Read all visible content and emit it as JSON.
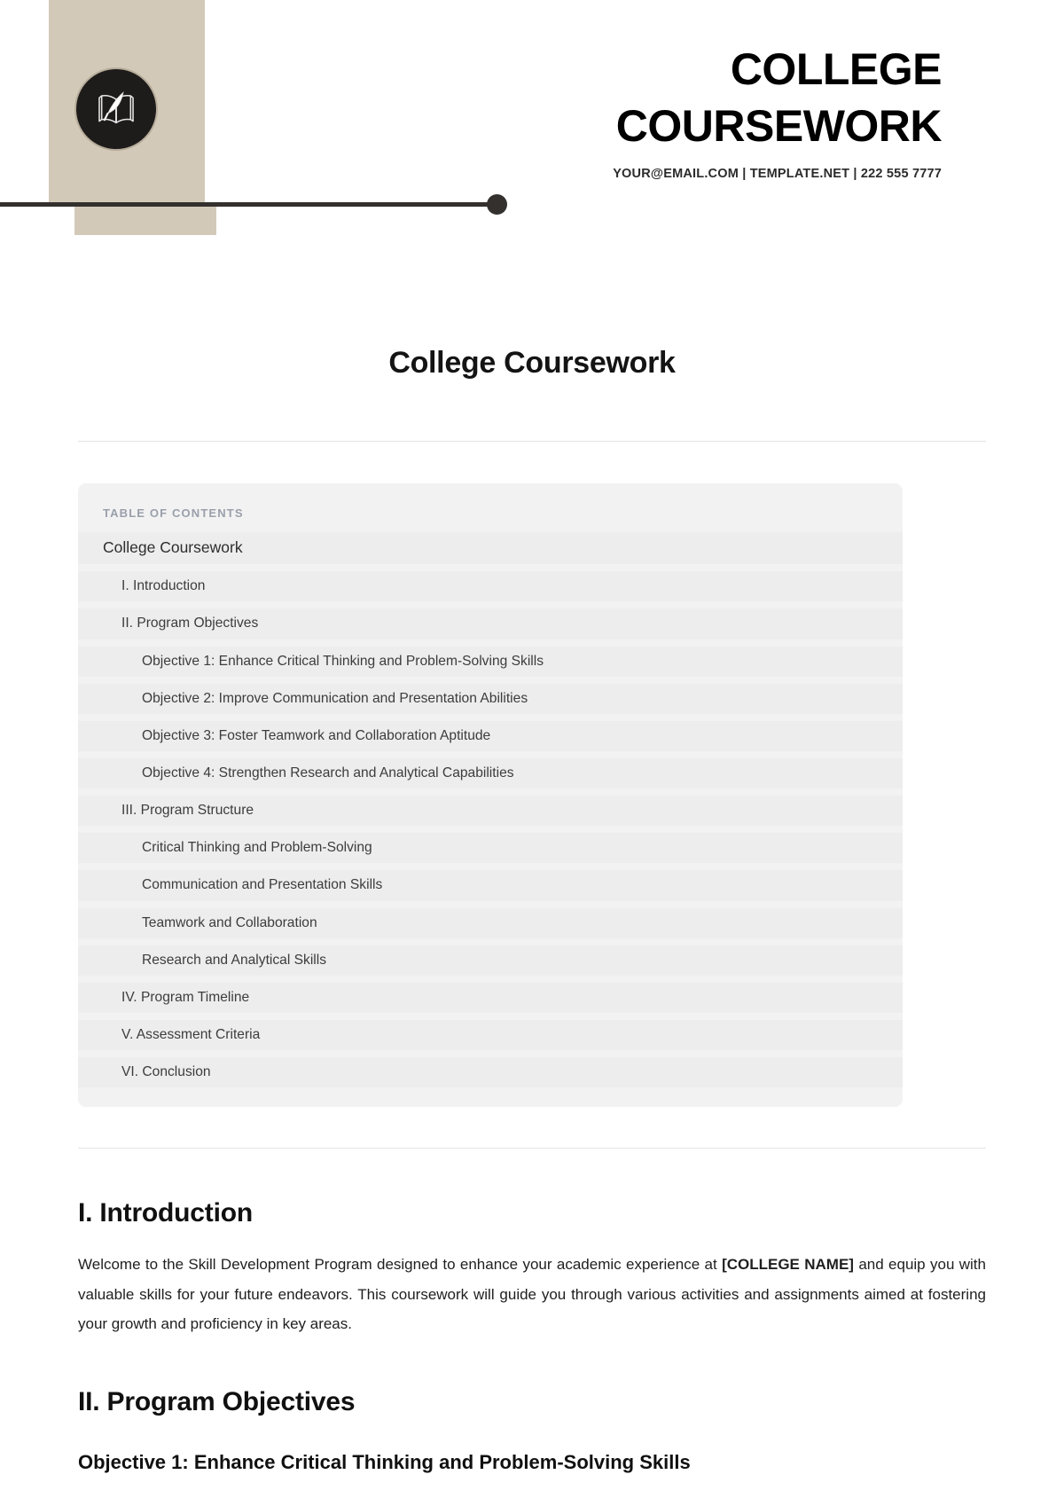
{
  "header": {
    "logo_icon": "open-book-quill-icon",
    "title_lines": [
      "COLLEGE",
      "COURSEWORK"
    ],
    "contact": "YOUR@EMAIL.COM | TEMPLATE.NET | 222 555 7777",
    "accent_beige": "#d3c9b8",
    "accent_dark": "#33302e"
  },
  "document": {
    "title": "College Coursework"
  },
  "toc": {
    "label": "TABLE OF CONTENTS",
    "items": [
      {
        "text": "College Coursework",
        "level": 0
      },
      {
        "text": "I. Introduction",
        "level": 1
      },
      {
        "text": "II. Program Objectives",
        "level": 1
      },
      {
        "text": "Objective 1: Enhance Critical Thinking and Problem-Solving Skills",
        "level": 2
      },
      {
        "text": "Objective 2: Improve Communication and Presentation Abilities",
        "level": 2
      },
      {
        "text": "Objective 3: Foster Teamwork and Collaboration Aptitude",
        "level": 2
      },
      {
        "text": "Objective 4: Strengthen Research and Analytical Capabilities",
        "level": 2
      },
      {
        "text": "III. Program Structure",
        "level": 1
      },
      {
        "text": "Critical Thinking and Problem-Solving",
        "level": 2
      },
      {
        "text": "Communication and Presentation Skills",
        "level": 2
      },
      {
        "text": "Teamwork and Collaboration",
        "level": 2
      },
      {
        "text": "Research and Analytical Skills",
        "level": 2
      },
      {
        "text": "IV. Program Timeline",
        "level": 1
      },
      {
        "text": "V. Assessment Criteria",
        "level": 1
      },
      {
        "text": "VI. Conclusion",
        "level": 1
      }
    ]
  },
  "sections": {
    "introduction": {
      "heading": "I. Introduction",
      "paragraph_before": "Welcome to the Skill Development Program designed to enhance your academic experience at ",
      "paragraph_bold": "[COLLEGE NAME]",
      "paragraph_after": " and equip you with valuable skills for your future endeavors. This coursework will guide you through various activities and assignments aimed at fostering your growth and proficiency in key areas."
    },
    "objectives": {
      "heading": "II. Program Objectives",
      "first_objective": "Objective 1: Enhance Critical Thinking and Problem-Solving Skills"
    }
  }
}
